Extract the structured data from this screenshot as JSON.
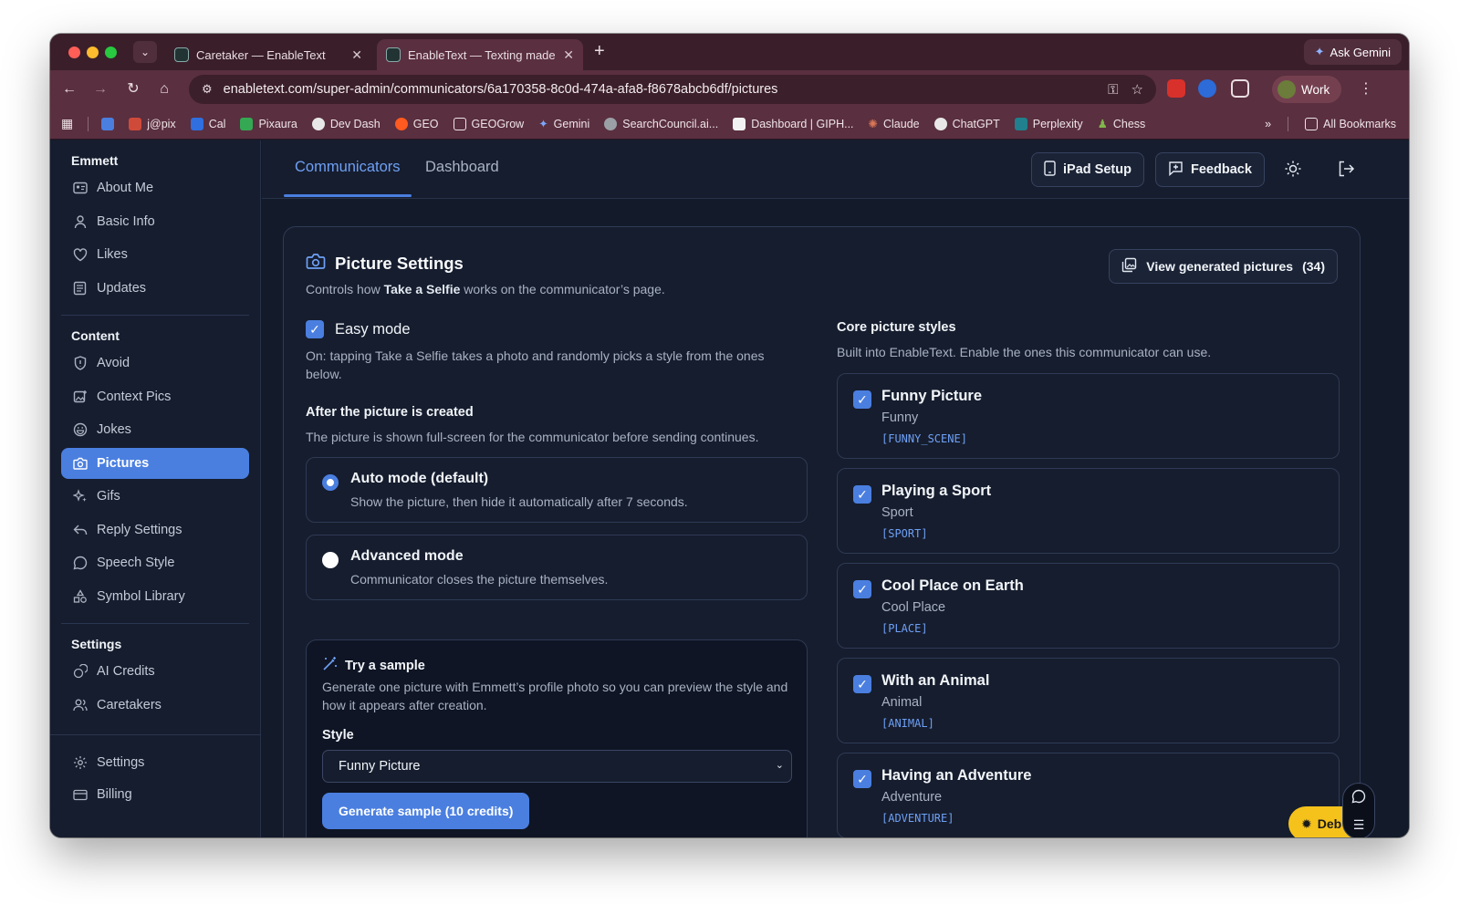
{
  "browser": {
    "tabs": [
      {
        "title": "Caretaker — EnableText",
        "active": false
      },
      {
        "title": "EnableText — Texting made e",
        "active": true
      }
    ],
    "ask_gemini": "Ask Gemini",
    "url": "enabletext.com/super-admin/communicators/6a170358-8c0d-474a-afa8-f8678abcb6df/pictures",
    "profile": "Work",
    "bookmarks": [
      {
        "label": "",
        "color": "#4a7fe0"
      },
      {
        "label": "j@pix",
        "color": "#d04a3a"
      },
      {
        "label": "Cal",
        "color": "#2f6fe0"
      },
      {
        "label": "Pixaura",
        "color": "#34a853"
      },
      {
        "label": "Dev Dash",
        "color": "#e8e8e8"
      },
      {
        "label": "GEO",
        "color": "#ff5a1f"
      },
      {
        "label": "GEOGrow",
        "color": "#5a2f3f"
      },
      {
        "label": "Gemini",
        "color": "#7aa7ff"
      },
      {
        "label": "SearchCouncil.ai...",
        "color": "#9aa0a6"
      },
      {
        "label": "Dashboard | GIPH...",
        "color": "#f2f2f2"
      },
      {
        "label": "Claude",
        "color": "#d97757"
      },
      {
        "label": "ChatGPT",
        "color": "#e8e8e8"
      },
      {
        "label": "Perplexity",
        "color": "#20808d"
      },
      {
        "label": "Chess",
        "color": "#81b64c"
      }
    ],
    "all_bookmarks": "All Bookmarks"
  },
  "sidebar": {
    "user": "Emmett",
    "top_items": [
      "About Me",
      "Basic Info",
      "Likes",
      "Updates"
    ],
    "content_title": "Content",
    "content_items": [
      "Avoid",
      "Context Pics",
      "Jokes",
      "Pictures",
      "Gifs",
      "Reply Settings",
      "Speech Style",
      "Symbol Library"
    ],
    "active_item": "Pictures",
    "settings_title": "Settings",
    "settings_items": [
      "AI Credits",
      "Caretakers"
    ],
    "bottom_items": [
      "Settings",
      "Billing"
    ]
  },
  "topnav": {
    "tabs": [
      "Communicators",
      "Dashboard"
    ],
    "active_tab": "Communicators",
    "ipad_setup": "iPad Setup",
    "feedback": "Feedback"
  },
  "picture_settings": {
    "title": "Picture Settings",
    "subtitle_pre": "Controls how ",
    "subtitle_bold": "Take a Selfie",
    "subtitle_post": " works on the communicator’s page.",
    "view_generated_label": "View generated pictures",
    "view_generated_count": "(34)",
    "easy_mode": {
      "label": "Easy mode",
      "checked": true,
      "description": "On: tapping Take a Selfie takes a photo and randomly picks a style from the ones below."
    },
    "after_heading": "After the picture is created",
    "after_description": "The picture is shown full-screen for the communicator before sending continues.",
    "modes": [
      {
        "title": "Auto mode (default)",
        "description": "Show the picture, then hide it automatically after 7 seconds.",
        "selected": true
      },
      {
        "title": "Advanced mode",
        "description": "Communicator closes the picture themselves.",
        "selected": false
      }
    ],
    "sample": {
      "title": "Try a sample",
      "description": "Generate one picture with Emmett’s profile photo so you can preview the style and how it appears after creation.",
      "style_label": "Style",
      "style_value": "Funny Picture",
      "generate_label": "Generate sample (10 credits)"
    },
    "core": {
      "heading": "Core picture styles",
      "description": "Built into EnableText. Enable the ones this communicator can use.",
      "styles": [
        {
          "name": "Funny Picture",
          "short": "Funny",
          "code": "[FUNNY_SCENE]",
          "checked": true
        },
        {
          "name": "Playing a Sport",
          "short": "Sport",
          "code": "[SPORT]",
          "checked": true
        },
        {
          "name": "Cool Place on Earth",
          "short": "Cool Place",
          "code": "[PLACE]",
          "checked": true
        },
        {
          "name": "With an Animal",
          "short": "Animal",
          "code": "[ANIMAL]",
          "checked": true
        },
        {
          "name": "Having an Adventure",
          "short": "Adventure",
          "code": "[ADVENTURE]",
          "checked": true
        }
      ]
    }
  },
  "debug_label": "Deb",
  "colors": {
    "accent": "#4a7fe0",
    "background": "#131a2a",
    "card": "#161d2e",
    "debug": "#f5c21b"
  }
}
